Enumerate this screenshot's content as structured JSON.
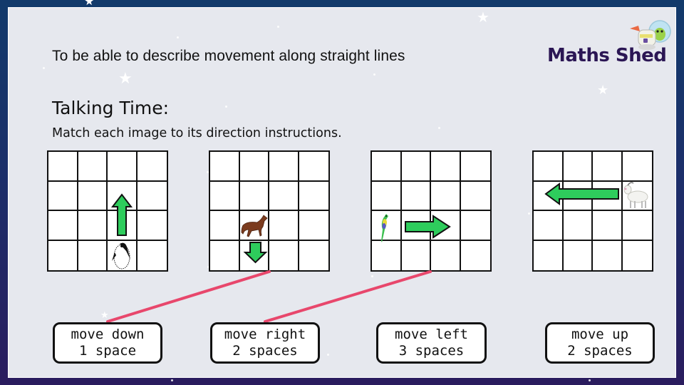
{
  "objective": "To be able to describe movement along straight lines",
  "logo": {
    "text": "Maths Shed",
    "icon": "astronaut-mascot-icon"
  },
  "heading": "Talking Time:",
  "instruction": "Match each image to its direction instructions.",
  "colors": {
    "arrow_fill": "#2ecc5c",
    "match_line": "#e8476c",
    "logo_text": "#2b1654",
    "slide_bg": "#e6e8ee"
  },
  "grids": [
    {
      "name": "penguin-grid",
      "animal": "penguin",
      "animal_cell": [
        3,
        2
      ],
      "arrow": {
        "direction": "up",
        "spaces": 2
      }
    },
    {
      "name": "horse-grid",
      "animal": "horse",
      "animal_cell": [
        2,
        1
      ],
      "arrow": {
        "direction": "down",
        "spaces": 1
      }
    },
    {
      "name": "parrot-grid",
      "animal": "parrot",
      "animal_cell": [
        2,
        0
      ],
      "arrow": {
        "direction": "right",
        "spaces": 2
      }
    },
    {
      "name": "goat-grid",
      "animal": "goat",
      "animal_cell": [
        1,
        3
      ],
      "arrow": {
        "direction": "left",
        "spaces": 3
      }
    }
  ],
  "cards": [
    {
      "line1": "move down",
      "line2": "1 space"
    },
    {
      "line1": "move right",
      "line2": "2 spaces"
    },
    {
      "line1": "move left",
      "line2": "3 spaces"
    },
    {
      "line1": "move up",
      "line2": "2 spaces"
    }
  ],
  "matches": [
    {
      "grid": "horse-grid",
      "card": "move down 1 space"
    },
    {
      "grid": "parrot-grid",
      "card": "move right 2 spaces"
    }
  ]
}
